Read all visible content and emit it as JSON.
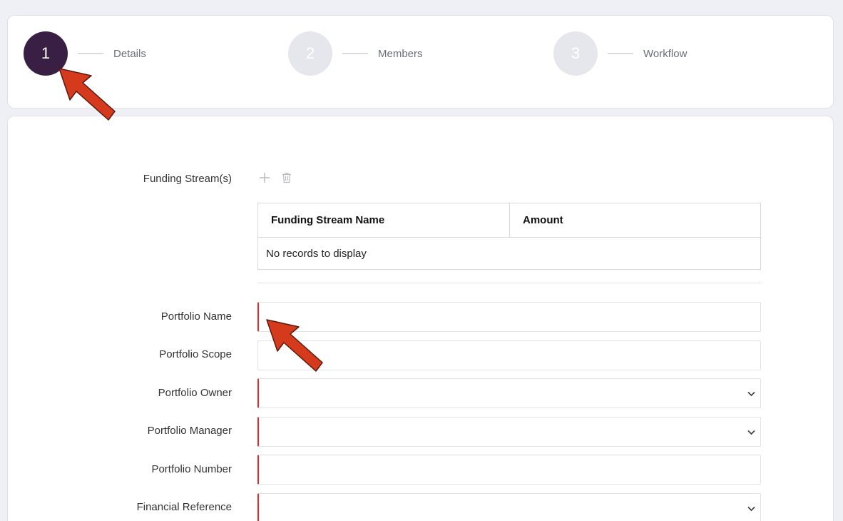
{
  "stepper": {
    "steps": [
      {
        "number": "1",
        "label": "Details",
        "state": "active"
      },
      {
        "number": "2",
        "label": "Members",
        "state": "inactive"
      },
      {
        "number": "3",
        "label": "Workflow",
        "state": "inactive"
      }
    ]
  },
  "funding": {
    "label": "Funding Stream(s)",
    "add_icon": "plus-icon",
    "delete_icon": "trash-icon",
    "table": {
      "columns": [
        "Funding Stream Name",
        "Amount"
      ],
      "empty_text": "No records to display"
    }
  },
  "fields": {
    "portfolio_name": {
      "label": "Portfolio Name",
      "value": "",
      "required": true
    },
    "portfolio_scope": {
      "label": "Portfolio Scope",
      "value": "",
      "required": false
    },
    "portfolio_owner": {
      "label": "Portfolio Owner",
      "value": "",
      "required": true,
      "type": "select"
    },
    "portfolio_manager": {
      "label": "Portfolio Manager",
      "value": "",
      "required": true,
      "type": "select"
    },
    "portfolio_number": {
      "label": "Portfolio Number",
      "value": "",
      "required": true
    },
    "financial_reference": {
      "label": "Financial Reference",
      "value": "",
      "required": true,
      "type": "select"
    }
  },
  "colors": {
    "active_step": "#3a1f45",
    "inactive_step": "#e5e7ed",
    "required_marker": "#e8282b",
    "annotation_arrow": "#d63a1c"
  }
}
